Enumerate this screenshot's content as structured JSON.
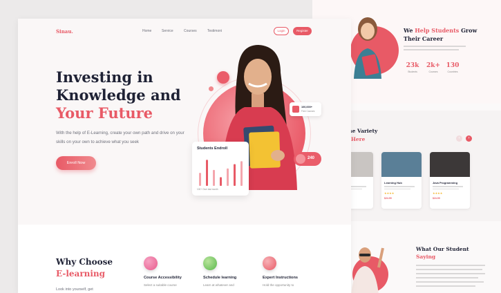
{
  "front": {
    "logo": "Sinau.",
    "nav": [
      "Home",
      "Service",
      "Courses",
      "Testimoni"
    ],
    "login_label": "Login",
    "register_label": "Register",
    "hero": {
      "title_line1": "Investing in",
      "title_line2": "Knowledge and",
      "title_accent": "Your Future",
      "desc": "With the help of E-Learning, create your own path and drive on your skills on your own to achieve what you seek",
      "cta_label": "Enroll Now"
    },
    "badge_top": {
      "value": "100,000+",
      "label": "Free Courses"
    },
    "badge_count": "240",
    "enroll_card": {
      "title": "Students Endroll",
      "footer": "100+ Over last month",
      "bars": [
        0.45,
        0.9,
        0.55,
        0.3,
        0.6,
        0.75,
        0.85
      ]
    },
    "why": {
      "title": "Why Choose",
      "title_accent": "E-learning",
      "subtitle": "Look into yourself, get",
      "features": [
        {
          "title": "Course Accessibility",
          "desc": "Select a suitable course",
          "color": "#e85a8c"
        },
        {
          "title": "Schedule learning",
          "desc": "Learn at whatever and",
          "color": "#59b84b"
        },
        {
          "title": "Expert Instructions",
          "desc": "Hold the opportunity to",
          "color": "#e85a66"
        }
      ]
    }
  },
  "back": {
    "help_prefix": "We",
    "help_accent": "Help Students",
    "help_rest": "Grow Their Career",
    "stats": [
      {
        "num": "23k",
        "label": "Students"
      },
      {
        "num": "2k+",
        "label": "Courses"
      },
      {
        "num": "130",
        "label": "Countries"
      }
    ],
    "variety_title": "r The Variety",
    "variety_accent": "ses Here",
    "courses": [
      {
        "title": "t Manager",
        "stars": "★★★★",
        "price": "$24.99",
        "img_color": "#c9c5c2"
      },
      {
        "title": "Learning Hub",
        "stars": "★★★★",
        "price": "$24.99",
        "img_color": "#5a7f97"
      },
      {
        "title": "Java Programming",
        "stars": "★★★★",
        "price": "$24.99",
        "img_color": "#3c3838"
      }
    ],
    "student_title": "What Our Student",
    "student_accent": "Saying"
  }
}
